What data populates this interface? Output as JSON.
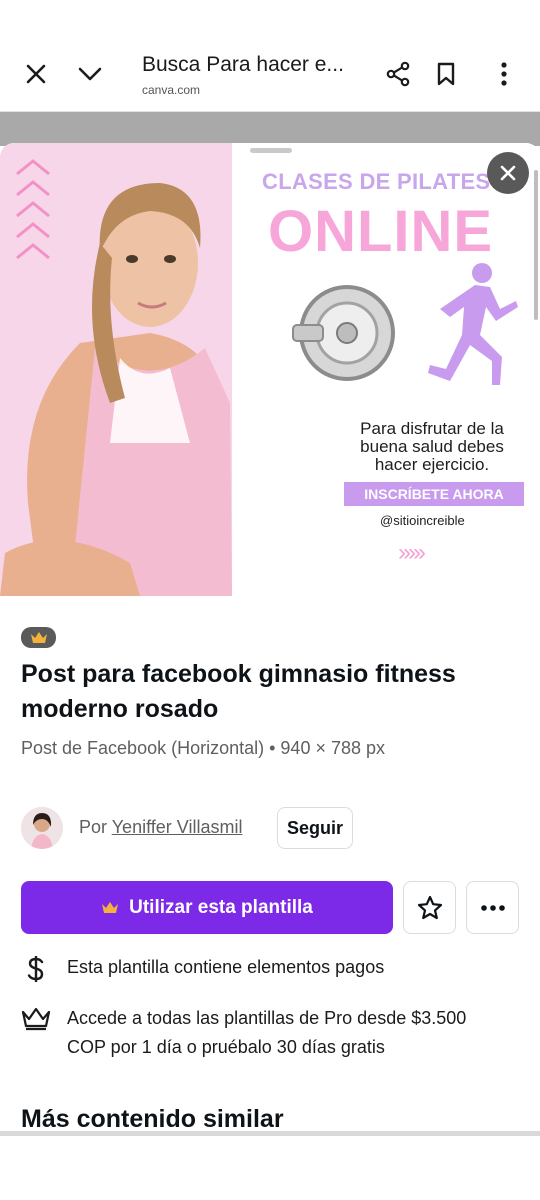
{
  "browser": {
    "title": "Busca Para hacer e...",
    "url": "canva.com",
    "icons": [
      "close-icon",
      "chevron-down-icon",
      "share-icon",
      "bookmark-icon",
      "more-vertical-icon"
    ]
  },
  "preview": {
    "heading": "CLASES DE PILATES",
    "headline": "ONLINE",
    "body": "Para disfrutar de la buena salud debes hacer ejercicio.",
    "cta": "INSCRÍBETE AHORA",
    "handle": "@sitioincreible",
    "arrows": "›››››",
    "colors": {
      "pink_bg": "#f7d6ea",
      "lilac": "#c89bee",
      "pink_text": "#f6a6d8"
    }
  },
  "details": {
    "title": "Post para facebook gimnasio fitness moderno rosado",
    "subtitle": "Post de Facebook (Horizontal) • 940 × 788 px",
    "by_prefix": "Por",
    "author": "Yeniffer Villasmil",
    "follow_label": "Seguir",
    "use_label": "Utilizar esta plantilla",
    "info": [
      {
        "icon": "dollar-icon",
        "text": "Esta plantilla contiene elementos pagos"
      },
      {
        "icon": "crown-icon",
        "text": "Accede a todas las plantillas de Pro desde $3.500 COP por 1 día o pruébalo 30 días gratis"
      }
    ],
    "more_heading": "Más contenido similar",
    "accent": "#7d2ae8"
  }
}
